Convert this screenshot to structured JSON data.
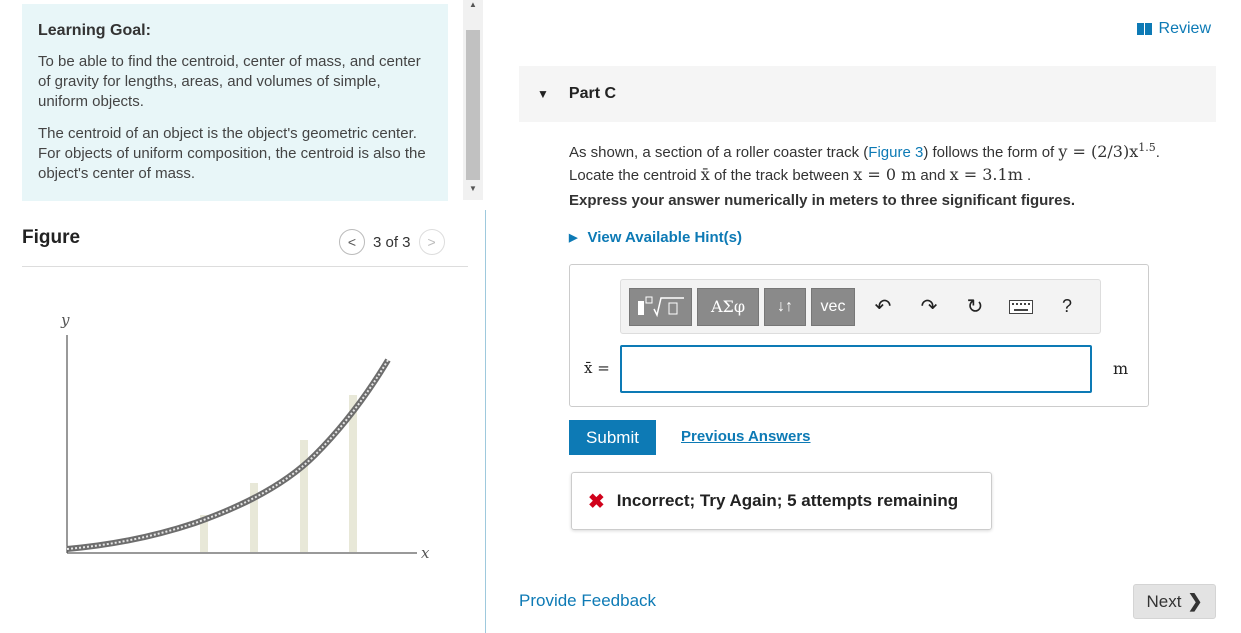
{
  "learning_goal": {
    "title": "Learning Goal:",
    "paragraph1": "To be able to find the centroid, center of mass, and center of gravity for lengths, areas, and volumes of simple, uniform objects.",
    "paragraph2": "The centroid of an object is the object's geometric center. For objects of uniform composition, the centroid is also the object's center of mass."
  },
  "figure": {
    "title": "Figure",
    "counter": "3 of 3",
    "y_axis_label": "y",
    "x_axis_label": "x"
  },
  "header": {
    "review_label": "Review",
    "part_title": "Part C"
  },
  "question": {
    "text_before": "As shown, a section of a roller coaster track (",
    "figure_link": "Figure 3",
    "text_mid": ") follows the form of ",
    "equation": "y = (2/3)x",
    "exponent": "1.5",
    "line2_pre": "Locate the centroid ",
    "xbar": "x̄",
    "line2_mid": " of the track between ",
    "bound1": "x = 0 m",
    "and_word": " and ",
    "bound2": "x = 3.1m",
    "period": " .",
    "instruction": "Express your answer numerically in meters to three significant figures.",
    "hints_label": "View Available Hint(s)"
  },
  "answer": {
    "variable_label": "x̄ =",
    "input_value": "",
    "unit": "m",
    "toolbar": {
      "greek": "ΑΣφ",
      "arrows": "↓↑",
      "vec": "vec",
      "help": "?"
    }
  },
  "actions": {
    "submit_label": "Submit",
    "previous_answers_label": "Previous Answers",
    "feedback_text": "Incorrect; Try Again; 5 attempts remaining",
    "provide_feedback_label": "Provide Feedback",
    "next_label": "Next"
  },
  "colors": {
    "accent": "#0d7ab5",
    "error": "#d0021b",
    "goal_bg": "#e8f6f8"
  }
}
